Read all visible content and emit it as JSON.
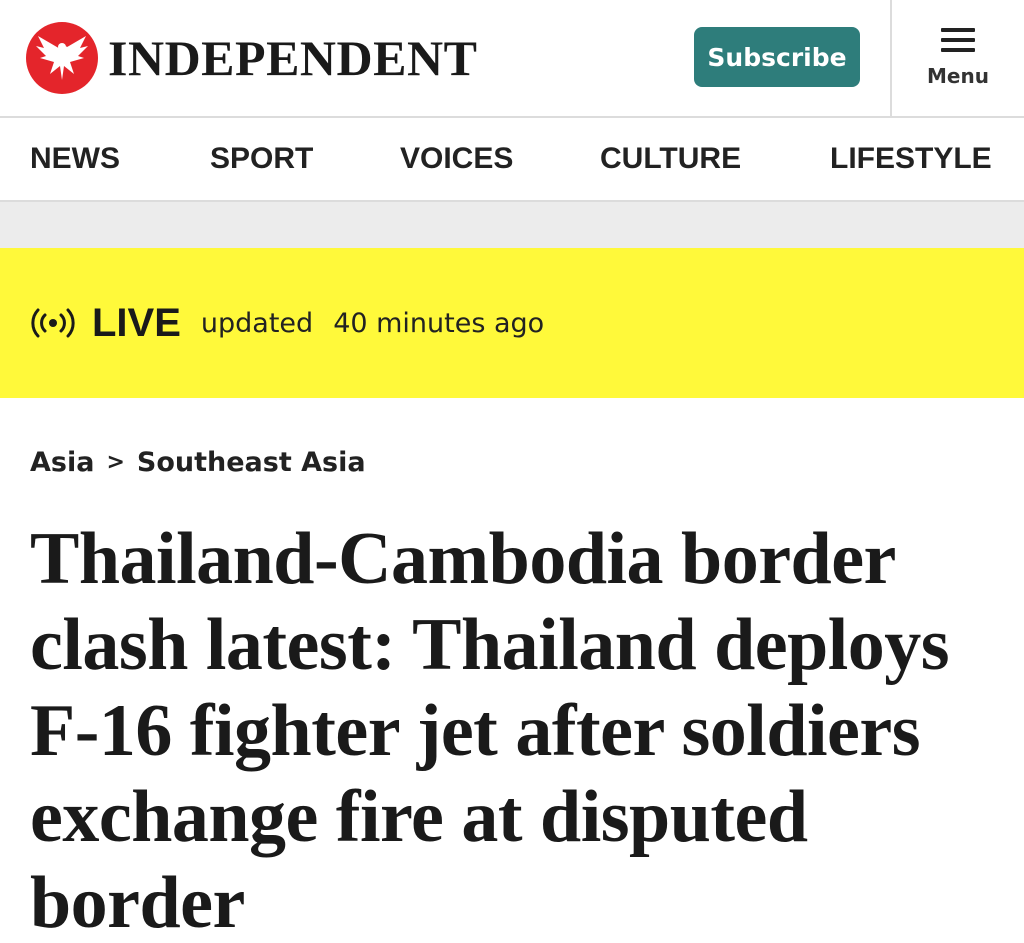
{
  "brand": {
    "name": "INDEPENDENT",
    "accent_color": "#e4252b",
    "logo_icon": "eagle-icon"
  },
  "header": {
    "subscribe_label": "Subscribe",
    "subscribe_color": "#2e7d7b",
    "menu_label": "Menu",
    "menu_icon": "hamburger-icon"
  },
  "nav": {
    "items": [
      {
        "label": "NEWS"
      },
      {
        "label": "SPORT"
      },
      {
        "label": "VOICES"
      },
      {
        "label": "CULTURE"
      },
      {
        "label": "LIFESTYLE"
      }
    ]
  },
  "live": {
    "label": "LIVE",
    "updated_text": "updated",
    "time_ago": "40 minutes ago",
    "banner_color": "#fff93a",
    "icon": "broadcast-icon"
  },
  "breadcrumb": {
    "items": [
      "Asia",
      "Southeast Asia"
    ],
    "separator": ">"
  },
  "article": {
    "headline": "Thailand-Cambodia border clash latest: Thailand deploys F-16 fighter jet after soldiers exchange fire at disputed border"
  }
}
